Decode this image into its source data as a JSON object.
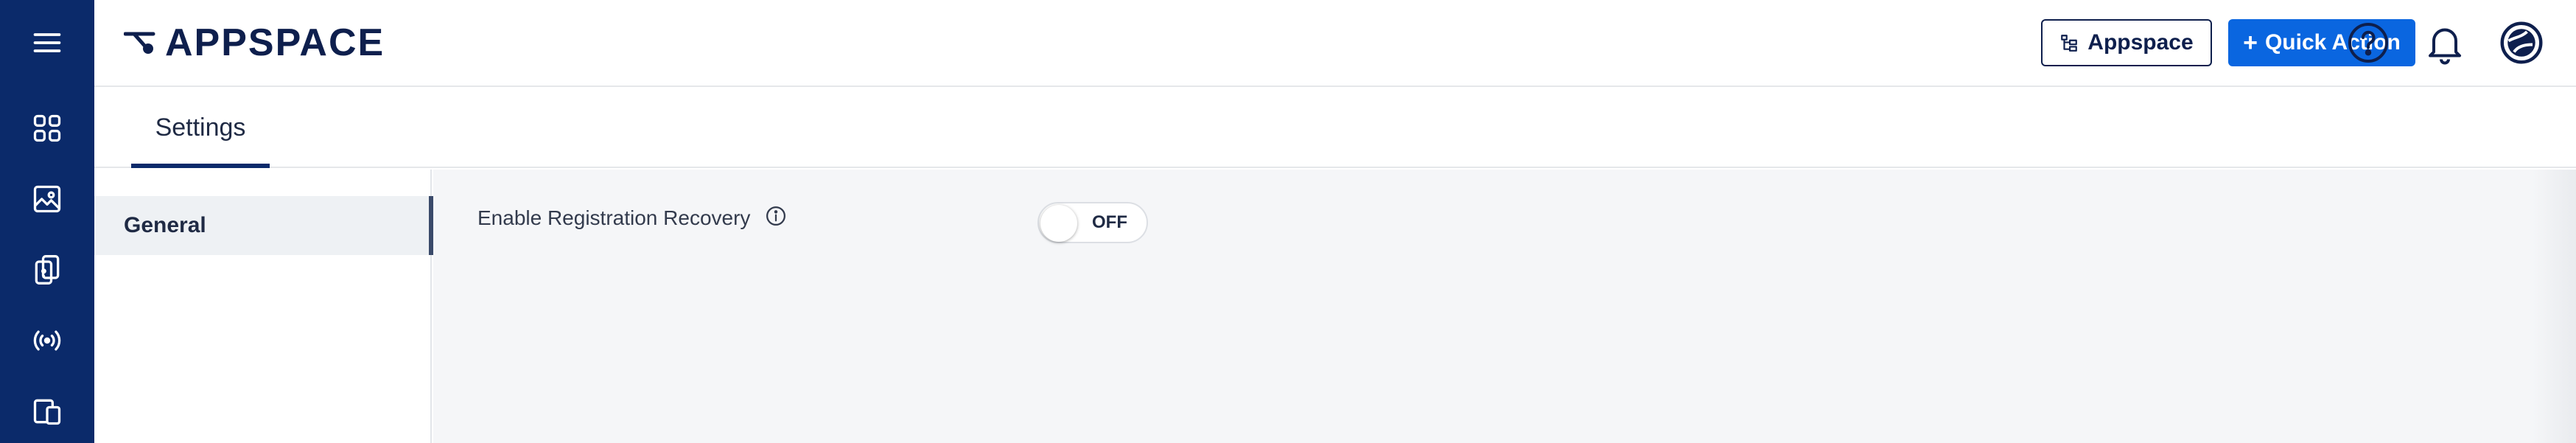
{
  "app": {
    "logo_text": "APPSPACE"
  },
  "rail": {
    "items": [
      {
        "icon": "menu-icon"
      },
      {
        "icon": "dashboard-grid-icon"
      },
      {
        "icon": "image-icon"
      },
      {
        "icon": "content-library-icon"
      },
      {
        "icon": "broadcast-icon"
      },
      {
        "icon": "devices-icon"
      }
    ]
  },
  "header": {
    "appspace_button_label": "Appspace",
    "quick_action_label": "Quick Action",
    "quick_action_plus": "+",
    "icons": [
      "help-icon",
      "bell-icon",
      "account-globe-icon"
    ]
  },
  "tabs": [
    {
      "label": "Settings",
      "active": true
    }
  ],
  "settings_nav": {
    "items": [
      {
        "label": "General",
        "selected": true
      }
    ]
  },
  "main": {
    "setting_label": "Enable Registration Recovery",
    "toggle_state": "OFF"
  },
  "colors": {
    "rail_bg": "#0b2a6a",
    "primary": "#0a66e0",
    "brand_text": "#0e1f4d",
    "content_bg": "#f5f6f8"
  }
}
